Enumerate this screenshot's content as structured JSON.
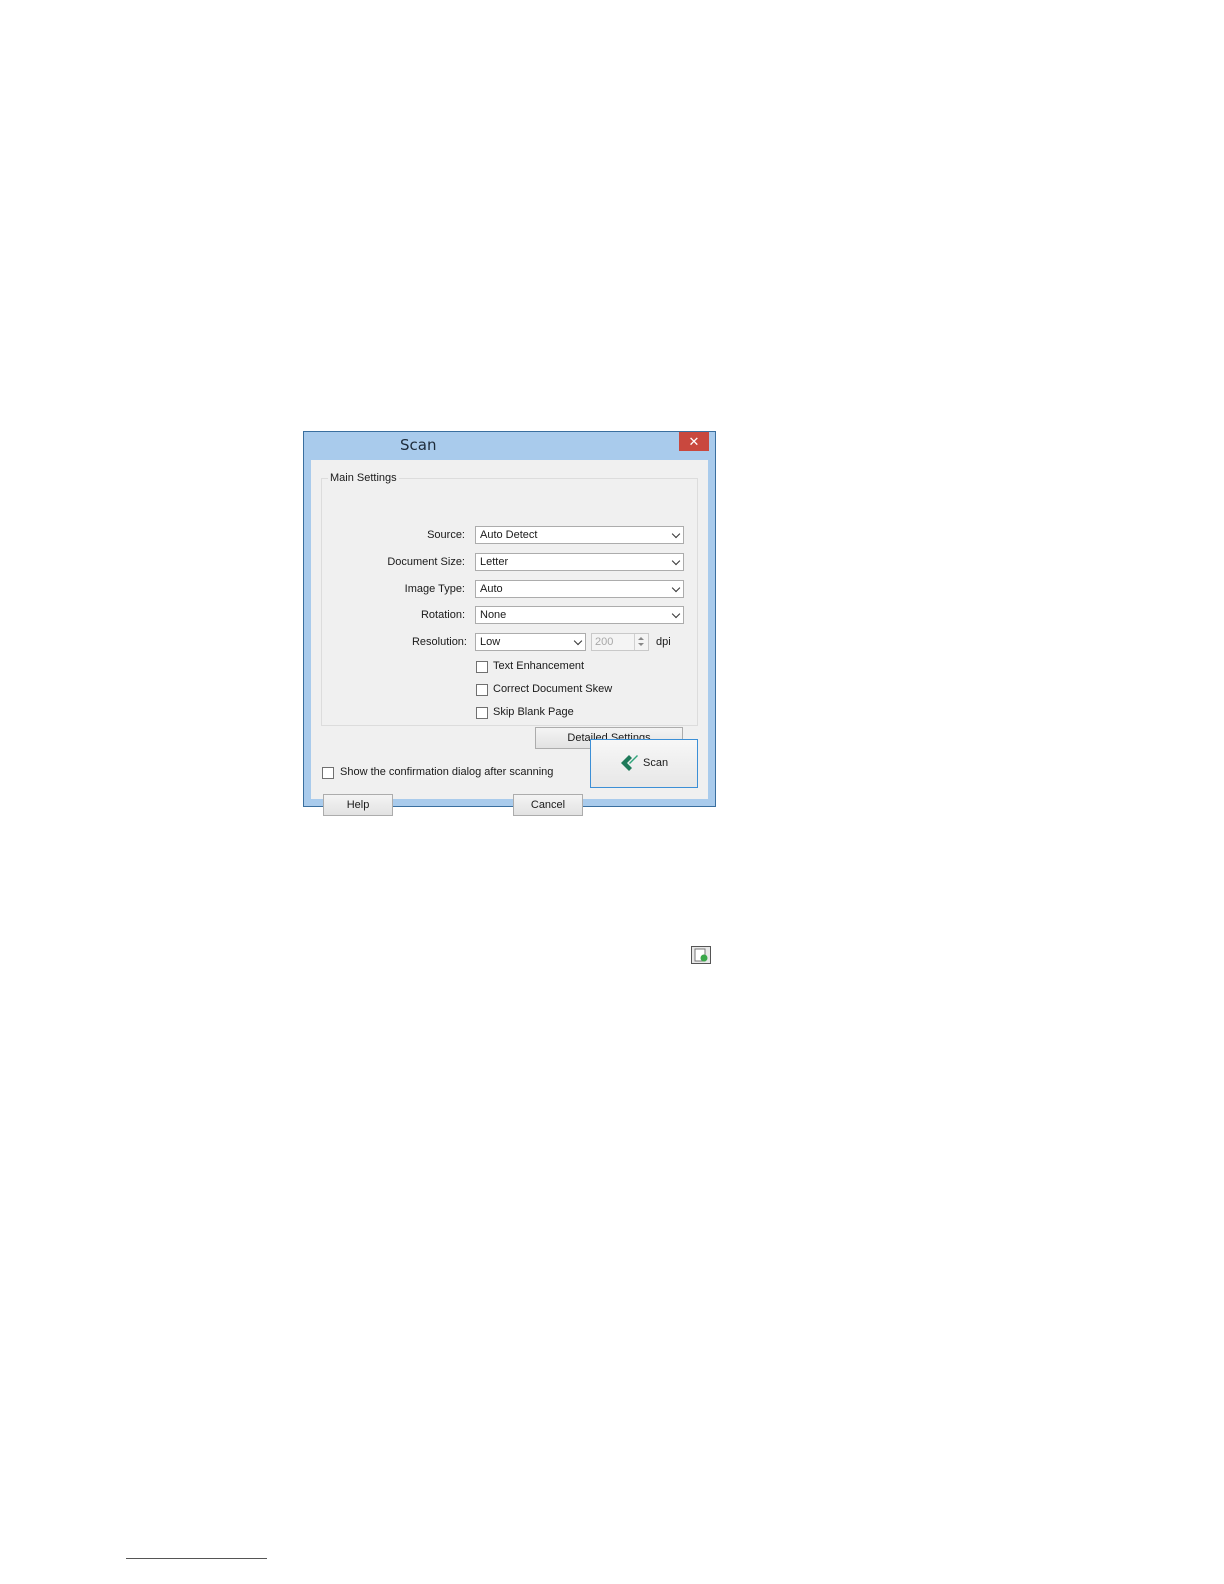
{
  "dialog": {
    "title": "Scan",
    "close_glyph": "✕",
    "group_title": "Main Settings",
    "fields": {
      "source": {
        "label": "Source:",
        "value": "Auto Detect"
      },
      "document_size": {
        "label": "Document Size:",
        "value": "Letter"
      },
      "image_type": {
        "label": "Image Type:",
        "value": "Auto"
      },
      "rotation": {
        "label": "Rotation:",
        "value": "None"
      },
      "resolution": {
        "label": "Resolution:",
        "value": "Low",
        "dpi_value": "200",
        "unit": "dpi"
      }
    },
    "checkboxes": {
      "text_enhancement": {
        "label": "Text Enhancement",
        "checked": false
      },
      "correct_document_skew": {
        "label": "Correct Document Skew",
        "checked": false
      },
      "skip_blank_page": {
        "label": "Skip Blank Page",
        "checked": false
      },
      "show_confirmation": {
        "label": "Show the confirmation dialog after scanning",
        "checked": false
      }
    },
    "buttons": {
      "detailed_settings": "Detailed Settings",
      "help": "Help",
      "cancel": "Cancel",
      "scan": "Scan"
    },
    "colors": {
      "frame": "#a9cbec",
      "close": "#c9483e",
      "scan_icon": "#1f7a5a",
      "scan_button_border": "#3c8fd6"
    }
  },
  "icons": {
    "close": "close-icon",
    "scan": "scan-logo-icon",
    "inline": "scanner-preview-icon"
  }
}
